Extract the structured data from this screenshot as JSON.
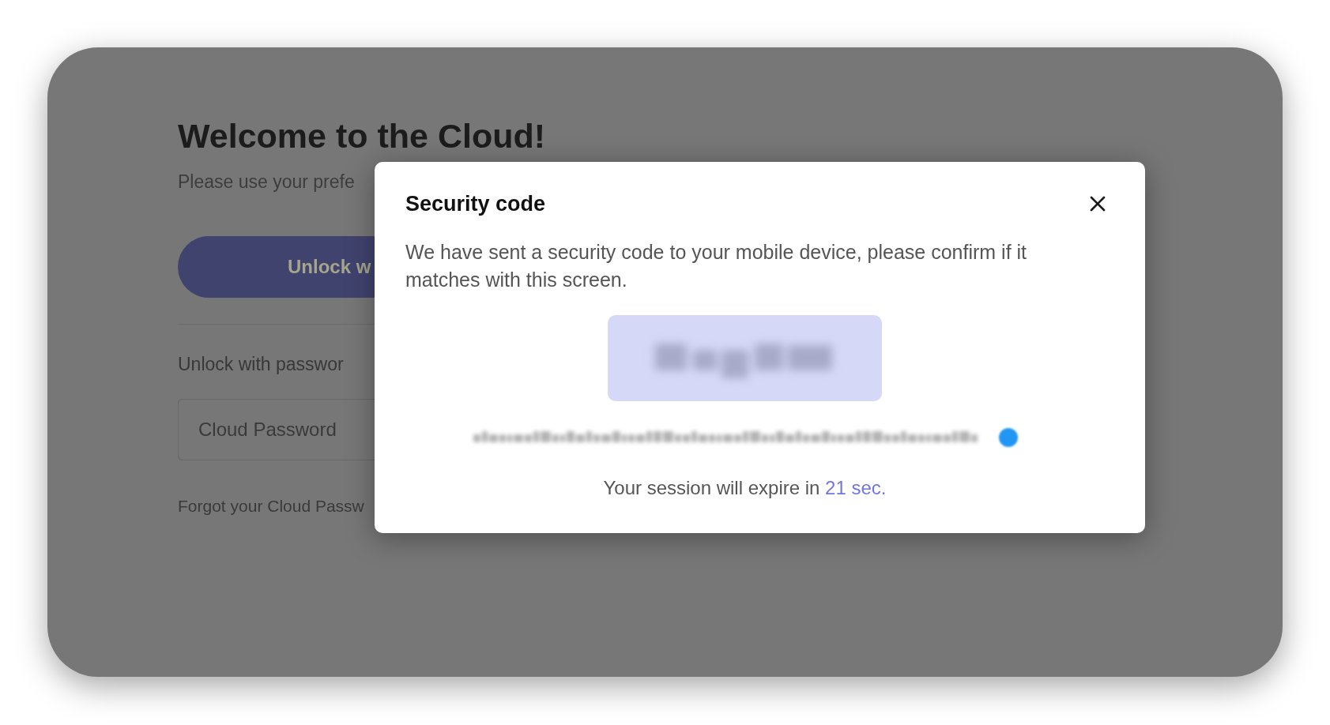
{
  "background": {
    "title": "Welcome to the Cloud!",
    "subtitle": "Please use your prefe",
    "unlock_button": "Unlock w",
    "password_label": "Unlock with passwor",
    "password_field": {
      "placeholder": "Cloud Password"
    },
    "forgot_link": "Forgot your Cloud Passw"
  },
  "dialog": {
    "title": "Security code",
    "message": "We have sent a security code to your mobile device, please confirm if it matches with this screen.",
    "session_text": "Your session will expire in",
    "countdown": "21 sec."
  }
}
